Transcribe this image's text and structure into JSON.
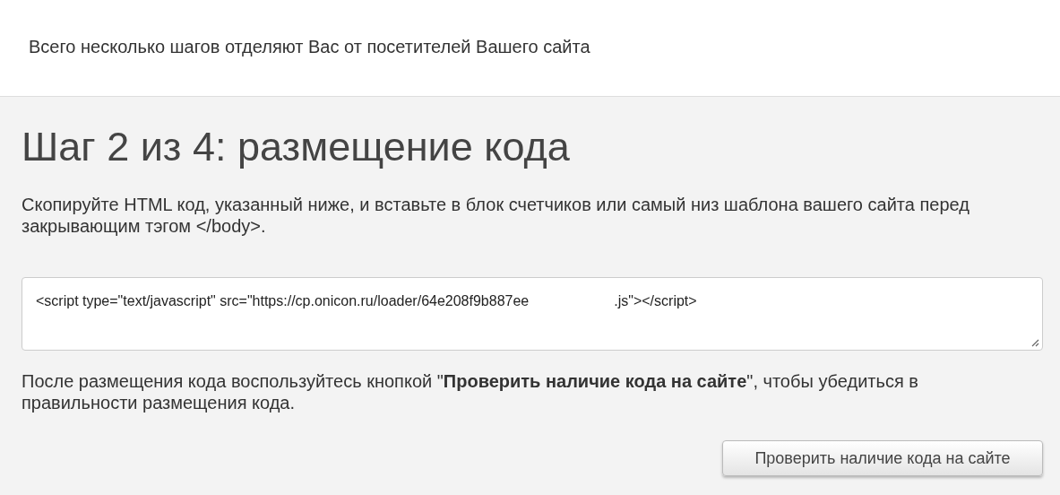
{
  "header": {
    "text": "Всего несколько шагов отделяют Вас от посетителей Вашего сайта"
  },
  "step_title": "Шаг 2 из 4: размещение кода",
  "instruction": "Скопируйте HTML код, указанный ниже, и вставьте в блок счетчиков или самый низ шаблона вашего сайта перед закрывающим тэгом </body>.",
  "code_field": {
    "value_before_redaction": "<script type=\"text/javascript\" src=\"https://cp.onicon.ru/loader/64e208f9b887ee",
    "value_after_redaction": ".js\"></script>"
  },
  "note": "После размещения кода воспользуйтесь кнопкой \"**Проверить наличие кода на сайте**\", чтобы убедиться в правильности размещения кода.",
  "buttons": [
    {
      "label": "Проверить наличие кода на сайте"
    }
  ]
}
